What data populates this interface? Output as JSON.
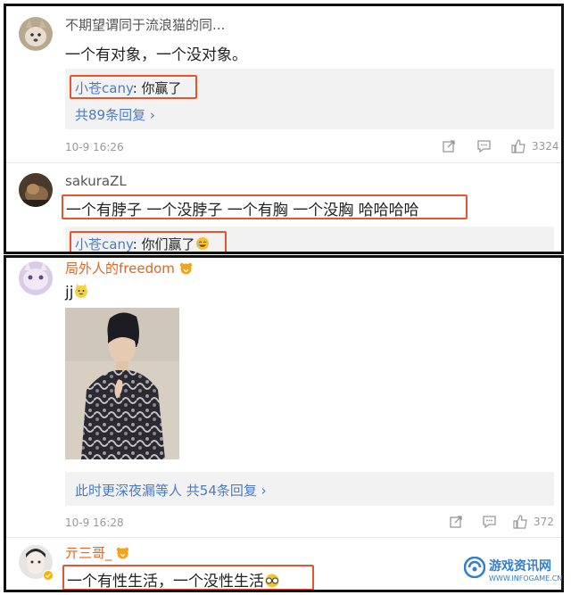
{
  "comments": [
    {
      "username": "不期望谓同于流浪猫的同...",
      "text": "一个有对象，一个没对象。",
      "reply_user": "小苍cany",
      "reply_text": ": 你赢了",
      "more_replies": "共89条回复 ›",
      "time": "10-9 16:26",
      "likes": "3324"
    },
    {
      "username": "sakuraZL",
      "text": "一个有脖子 一个没脖子 一个有胸 一个没胸 哈哈哈哈",
      "reply_user": "小苍cany",
      "reply_text": ": 你们赢了"
    },
    {
      "username": "局外人的freedom",
      "text": "jj",
      "reply_users": "此时更深夜漏等人",
      "more_replies": "共54条回复 ›",
      "time": "10-9 16:28",
      "likes": "372"
    },
    {
      "username": "亓三哥_",
      "text": "一个有性生活，一个没性生活"
    }
  ],
  "watermark": {
    "name": "游戏资讯网",
    "url": "WWW.INFOGAME.CN"
  },
  "colors": {
    "highlight": "#e8542c",
    "link": "#4c7bc4",
    "orange_name": "#e8631c"
  }
}
